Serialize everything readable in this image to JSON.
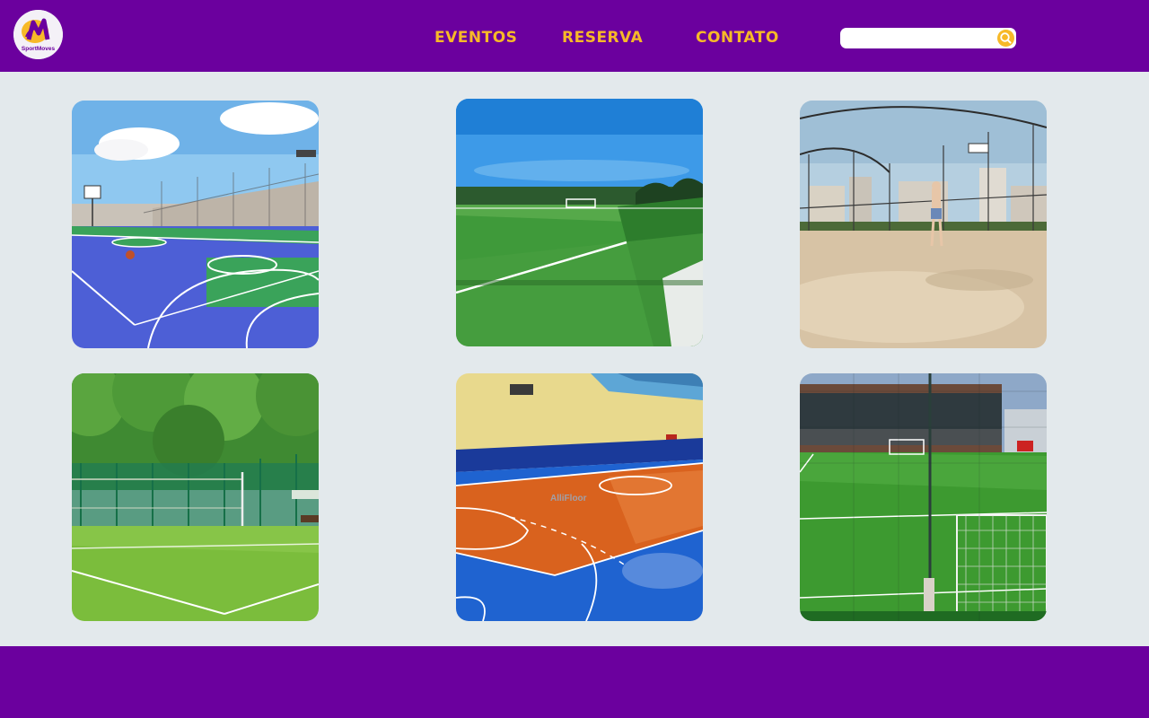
{
  "header": {
    "logo_text": "SportMoves",
    "nav": {
      "eventos": "EVENTOS",
      "reserva": "RESERVA",
      "contato": "CONTATO"
    },
    "search": {
      "placeholder": "",
      "value": ""
    }
  },
  "gallery": [
    {
      "subject": "blue multi-sport court with basketball hoop"
    },
    {
      "subject": "green synthetic football field"
    },
    {
      "subject": "sand beach-sport court with netting"
    },
    {
      "subject": "grass volleyball court with fence"
    },
    {
      "subject": "indoor orange and blue futsal court"
    },
    {
      "subject": "synthetic football field with goal and netting"
    }
  ],
  "colors": {
    "header_bg": "#6b009e",
    "nav_text": "#f7b928",
    "page_bg": "#e3e9ec",
    "footer_bg": "#6b009e"
  },
  "icons": {
    "search": "search-icon"
  }
}
